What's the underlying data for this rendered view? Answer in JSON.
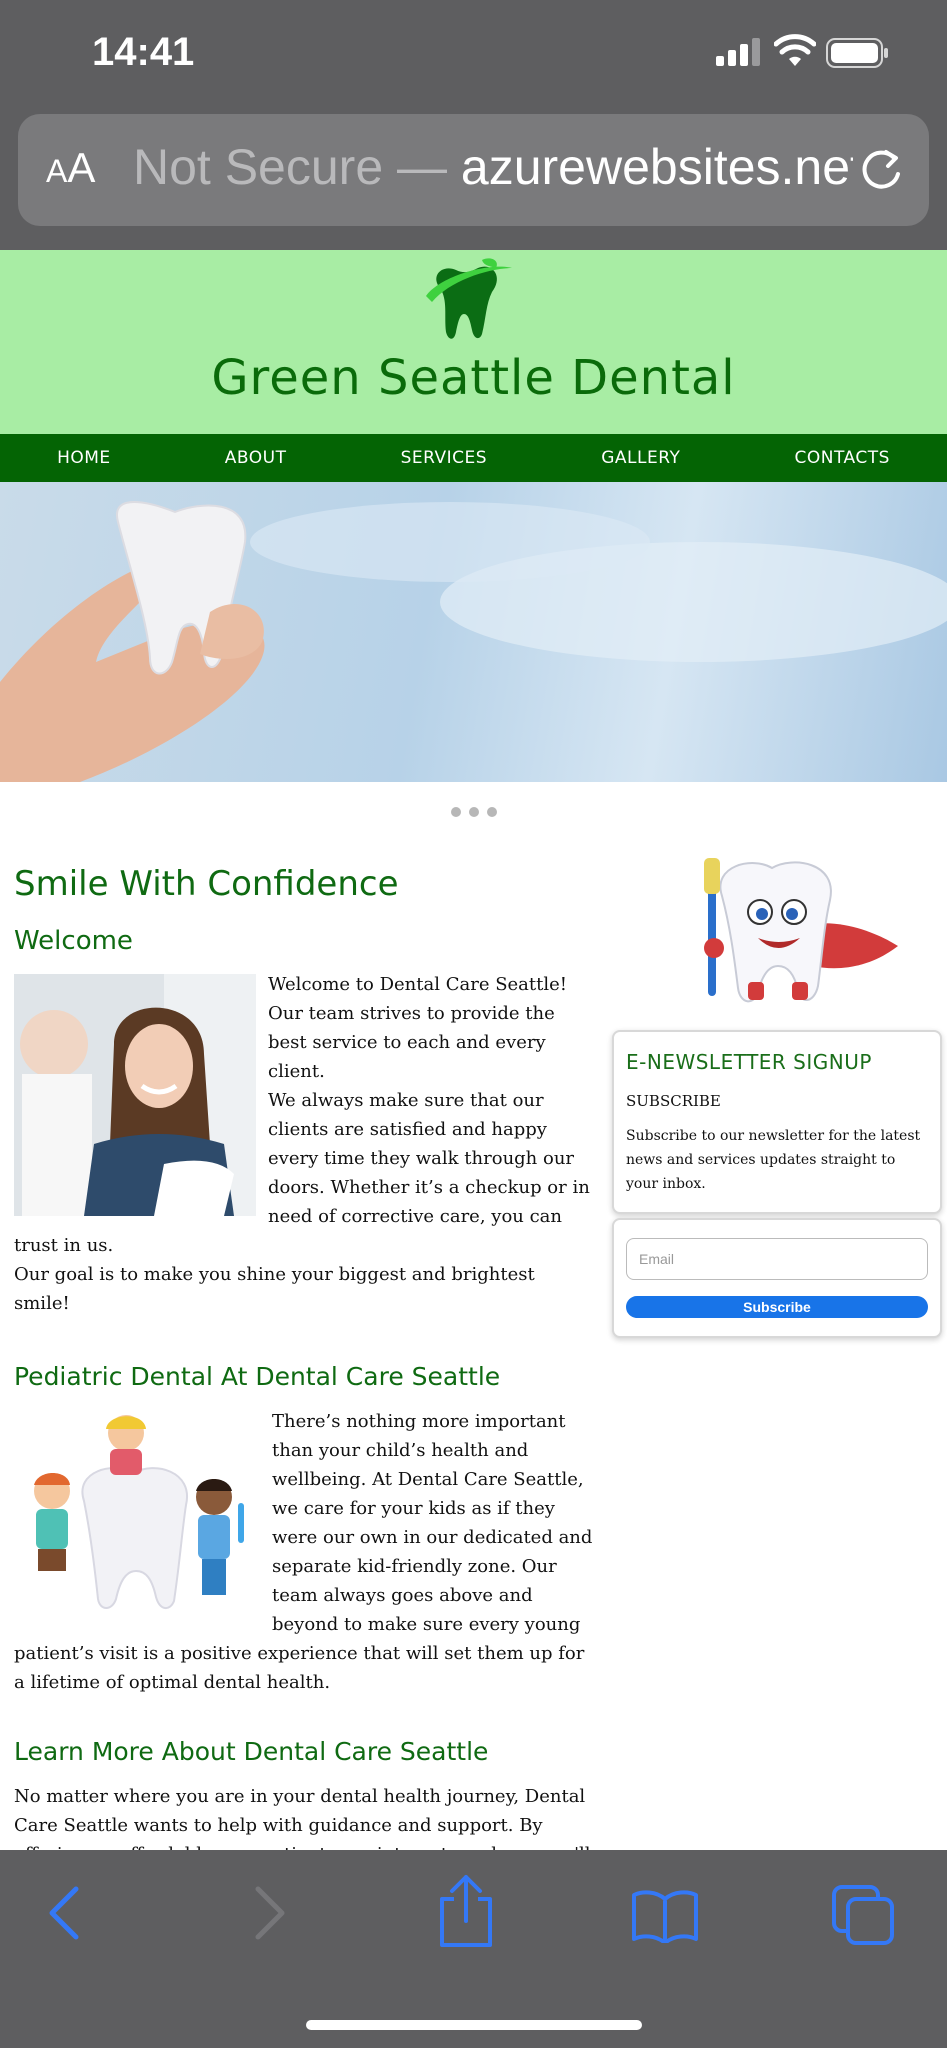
{
  "status_bar": {
    "time": "14:41"
  },
  "address_bar": {
    "text_size_label_big": "A",
    "text_size_label_small": "A",
    "security_label": "Not Secure — ",
    "host": "azurewebsites.net"
  },
  "site": {
    "brand": "Green Seattle Dental",
    "nav": [
      "HOME",
      "ABOUT",
      "SERVICES",
      "GALLERY",
      "CONTACTS"
    ]
  },
  "main": {
    "headline": "Smile With Confidence",
    "welcome_heading": "Welcome",
    "welcome_text": "Welcome to Dental Care Seattle! Our team strives to provide the best service to each and every client.",
    "welcome_text_2": "We always make sure that our clients are satisfied and happy every time they walk through our doors. Whether it’s a checkup or in need of corrective care, you can trust in us.",
    "welcome_text_3": "Our goal is to make you shine your biggest and brightest smile!",
    "pediatric_heading": "Pediatric Dental At Dental Care Seattle",
    "pediatric_text": "There’s nothing more important than your child’s health and wellbeing. At Dental Care Seattle, we care for your kids as if they were our own in our dedicated and separate kid-friendly zone. Our team always goes above and beyond to make sure every young patient’s visit is a positive experience that will set them up for a lifetime of optimal dental health.",
    "learn_heading": "Learn More About Dental Care Seattle",
    "learn_text": "No matter where you are in your dental health journey, Dental Care Seattle wants to help with guidance and support. By offering an affordable new patient appointment, we hope you'll call us today and become a patient for life!"
  },
  "sidebar": {
    "newsletter_title": "E-NEWSLETTER SIGNUP",
    "subscribe_label": "SUBSCRIBE",
    "newsletter_desc": "Subscribe to our newsletter for the latest news and services updates straight to your inbox.",
    "email_placeholder": "Email",
    "subscribe_button": "Subscribe"
  },
  "colors": {
    "header_bg": "#a8eda4",
    "nav_bg": "#046404",
    "heading_green": "#0f6a12",
    "button_blue": "#1874e8",
    "ios_blue": "#3478f6"
  },
  "icons": [
    "signal-icon",
    "wifi-icon",
    "battery-icon",
    "reload-icon",
    "back-icon",
    "forward-icon",
    "share-icon",
    "bookmarks-icon",
    "tabs-icon"
  ]
}
